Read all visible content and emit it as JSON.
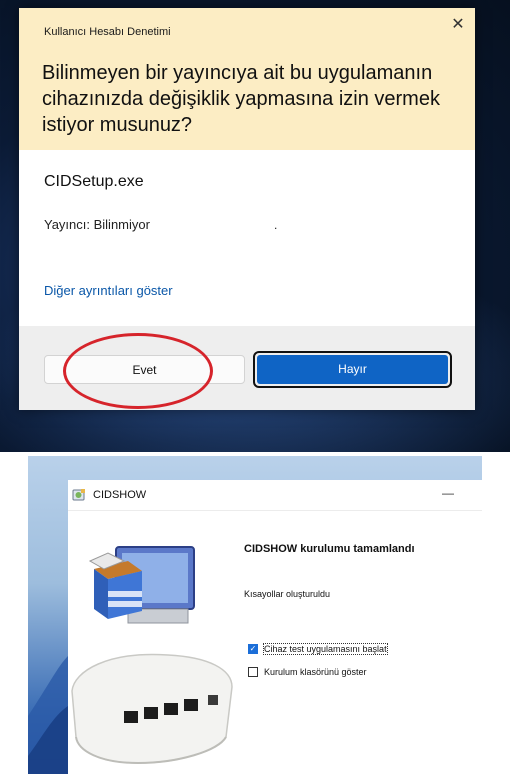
{
  "uac": {
    "title": "Kullanıcı Hesabı Denetimi",
    "question": "Bilinmeyen bir yayıncıya ait bu uygulamanın cihazınızda değişiklik yapmasına izin vermek istiyor musunuz?",
    "program": "CIDSetup.exe",
    "publisher": "Yayıncı: Bilinmiyor",
    "dot": ".",
    "more_details": "Diğer ayrıntıları göster",
    "yes_button": "Evet",
    "no_button": "Hayır",
    "close_icon": "close-icon"
  },
  "installer": {
    "window_title": "CIDSHOW",
    "minimize_icon": "minimize-icon",
    "heading": "CIDSHOW kurulumu tamamlandı",
    "shortcuts_text": "Kısayollar oluşturuldu",
    "checkboxes": [
      {
        "label": "Cihaz test uygulamasını başlat",
        "checked": true
      },
      {
        "label": "Kurulum klasörünü göster",
        "checked": false
      }
    ]
  },
  "colors": {
    "uac_header": "#fcedc4",
    "uac_link": "#0a57a8",
    "primary_button": "#0f64c5",
    "annotation_circle": "#d6242b",
    "checkbox_checked": "#1b6ed8"
  }
}
